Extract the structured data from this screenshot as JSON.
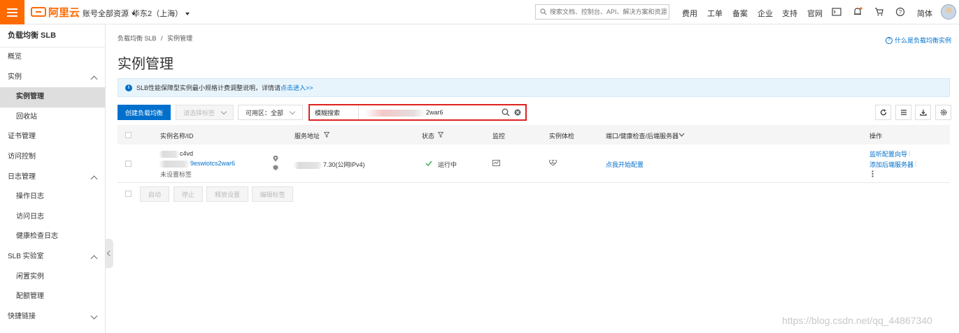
{
  "topbar": {
    "logo_text": "阿里云",
    "account_menu": "账号全部资源",
    "region_menu": "华东2（上海）",
    "search_placeholder": "搜索文档、控制台、API、解决方案和资源",
    "nav": [
      "费用",
      "工单",
      "备案",
      "企业",
      "支持",
      "官网"
    ],
    "language": "简体",
    "brand_color": "#ff6a00"
  },
  "sidebar": {
    "title": "负载均衡 SLB",
    "items": [
      {
        "label": "概览",
        "level": 1
      },
      {
        "label": "实例",
        "level": 1,
        "expanded": true
      },
      {
        "label": "实例管理",
        "level": 2,
        "active": true
      },
      {
        "label": "回收站",
        "level": 2
      },
      {
        "label": "证书管理",
        "level": 1
      },
      {
        "label": "访问控制",
        "level": 1
      },
      {
        "label": "日志管理",
        "level": 1,
        "expanded": true
      },
      {
        "label": "操作日志",
        "level": 2
      },
      {
        "label": "访问日志",
        "level": 2
      },
      {
        "label": "健康检查日志",
        "level": 2
      },
      {
        "label": "SLB 实验室",
        "level": 1,
        "expanded": true
      },
      {
        "label": "闲置实例",
        "level": 2
      },
      {
        "label": "配额管理",
        "level": 2
      },
      {
        "label": "快捷链接",
        "level": 1,
        "expanded": false
      }
    ]
  },
  "main": {
    "breadcrumb": [
      "负载均衡 SLB",
      "/",
      "实例管理"
    ],
    "help_link": "什么是负载均衡实例",
    "title": "实例管理",
    "notice_text": "SLB性能保障型实例最小规格计费调整说明，详情请",
    "notice_link": "点击进入>>",
    "toolbar": {
      "create_button": "创建负载均衡",
      "tag_select": "请选择标签",
      "zone_select": "可用区：全部",
      "search_type": "模糊搜索",
      "search_value_suffix": "2war6"
    },
    "table": {
      "headers": [
        "实例名称/ID",
        "服务地址",
        "状态",
        "监控",
        "实例体检",
        "端口/健康检查/后端服务器",
        "操作"
      ],
      "rows": [
        {
          "name_suffix": "c4vd",
          "id_suffix": "9eswiotcs2war6",
          "tag": "未设置标签",
          "address_suffix": "7.30(公网IPv4)",
          "status": "运行中",
          "port_link": "点我开始配置",
          "actions": [
            "监听配置向导",
            "添加后端服务器"
          ]
        }
      ]
    },
    "bulk_actions": [
      "启动",
      "停止",
      "释放设置",
      "编辑标签"
    ]
  },
  "watermark": "https://blog.csdn.net/qq_44867340",
  "colors": {
    "accent": "#0070cc",
    "highlight_border": "#e02020",
    "status_ok": "#2fae46"
  }
}
